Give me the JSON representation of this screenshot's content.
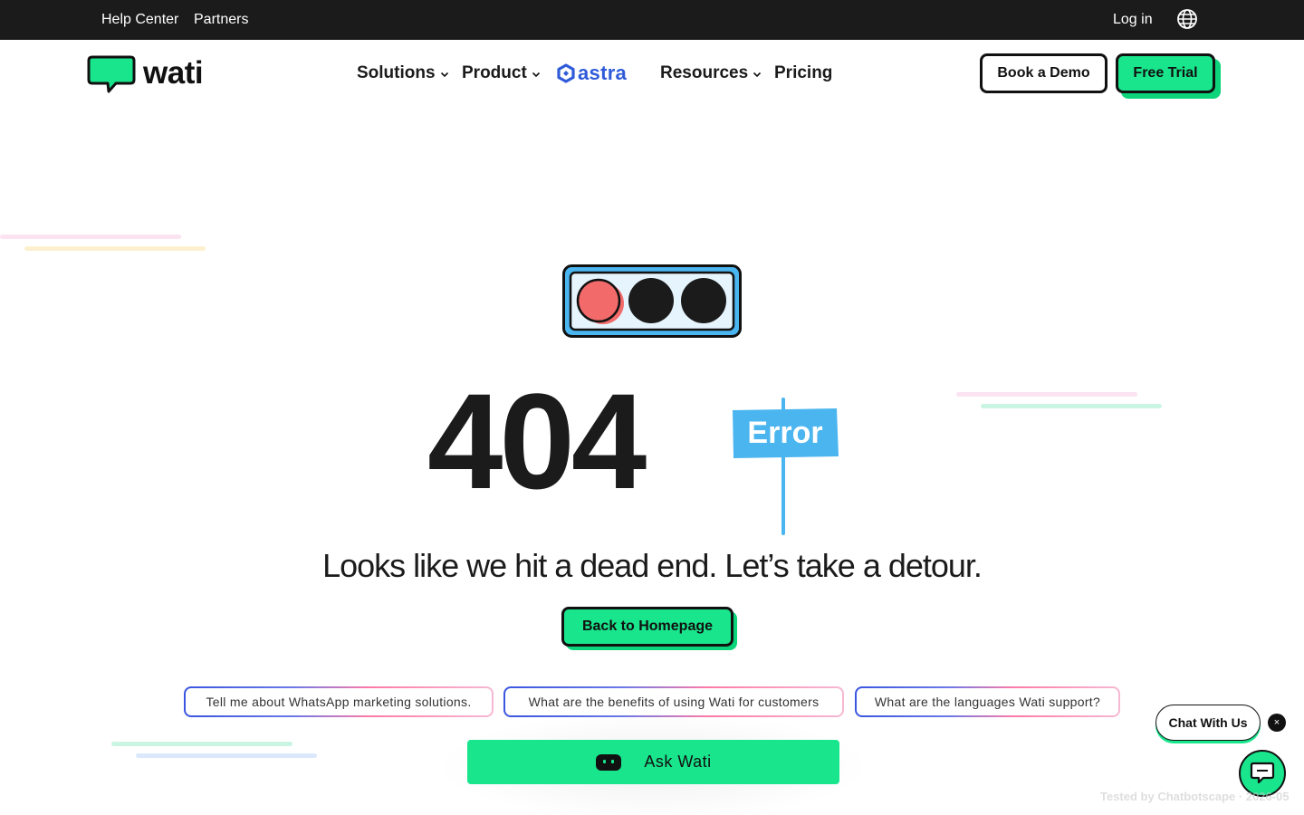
{
  "topbar": {
    "help_center": "Help Center",
    "partners": "Partners",
    "login": "Log in"
  },
  "header": {
    "logo_text": "wati",
    "nav": {
      "solutions": "Solutions",
      "product": "Product",
      "astra": "astra",
      "resources": "Resources",
      "pricing": "Pricing"
    },
    "book_demo": "Book a Demo",
    "free_trial": "Free Trial"
  },
  "main": {
    "code": "404",
    "sign_label": "Error",
    "headline": "Looks like we hit a dead end. Let’s take a detour.",
    "back_home": "Back to Homepage",
    "traffic_light_colors": [
      "#f26a6a",
      "#1b1b1b",
      "#1b1b1b"
    ]
  },
  "suggestions": [
    "Tell me about WhatsApp marketing solutions.",
    "What are the benefits of using Wati for customers",
    "What are the languages Wati support?"
  ],
  "ask": {
    "label": "Ask Wati"
  },
  "chat_widget": {
    "bubble": "Chat With Us",
    "close": "×"
  },
  "watermark": "Tested by Chatbotscape · 2026-05",
  "colors": {
    "brand_green": "#19e58c",
    "dark": "#1b1b1b",
    "sign_blue": "#4bb5ef",
    "astra_blue": "#2f5bd9"
  },
  "icons": {
    "globe": "globe-icon",
    "chevron": "chevron-down-icon",
    "logo": "chat-bubble-logo-icon",
    "astra": "astra-logo-icon",
    "ask": "robot-face-icon",
    "chat": "chat-icon"
  }
}
